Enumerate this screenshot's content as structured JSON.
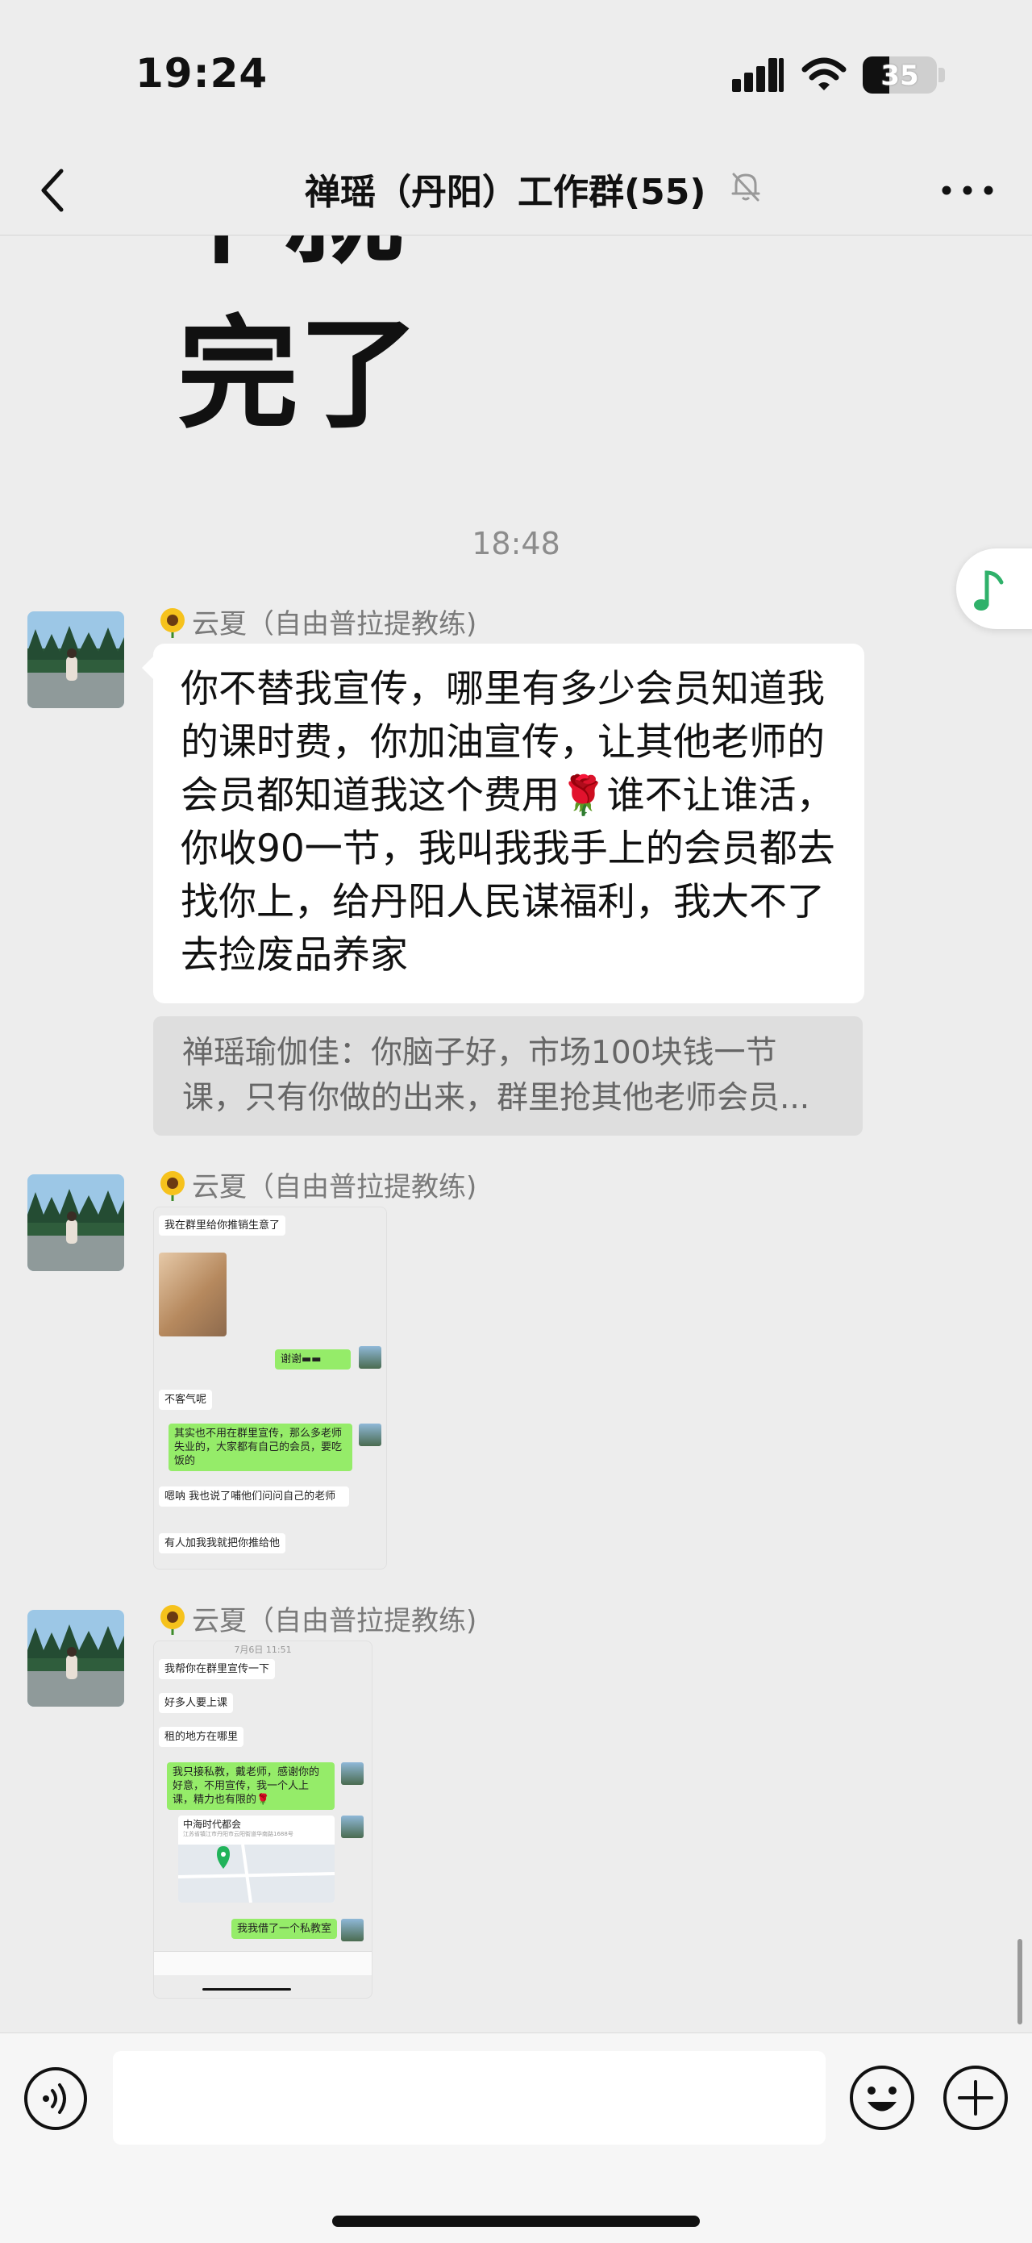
{
  "status_bar": {
    "time": "19:24",
    "battery": "35",
    "battery_level": 0.35
  },
  "nav": {
    "title": "禅瑶（丹阳）工作群(55)"
  },
  "chat": {
    "image_text_line1": "中就",
    "image_text_line2": "完了",
    "timestamp": "18:48",
    "messages": [
      {
        "sender": "云夏（自由普拉提教练)",
        "text": "你不替我宣传，哪里有多少会员知道我的课时费，你加油宣传，让其他老师的会员都知道我这个费用🌹谁不让谁活，你收90一节，我叫我我手上的会员都去找你上，给丹阳人民谋福利，我大不了去捡废品养家",
        "quote": "禅瑶瑜伽佳：你脑子好，市场100块钱一节课，只有你做的出来，群里抢其他老师会员..."
      },
      {
        "sender": "云夏（自由普拉提教练)",
        "screenshot": [
          "我在群里给你推销生意了",
          "谢谢",
          "不客气呢",
          "其实也不用在群里宣传，那么多老师失业的，大家都有自己的会员，要吃饭的",
          "嗯呐 我也说了哺他们问问自己的老师",
          "有人加我我就把你推给他"
        ]
      },
      {
        "sender": "云夏（自由普拉提教练)",
        "screenshot": [
          "7月6日 11:51",
          "我帮你在群里宣传一下",
          "好多人要上课",
          "租的地方在哪里",
          "我只接私教，戴老师，感谢你的好意，不用宣传，我一个人上课，精力也有限的🌹",
          "中海时代都会",
          "江苏省镇江市丹阳市云阳街道华南路1688号",
          "我我借了一个私教室"
        ]
      }
    ]
  },
  "input": {
    "placeholder": ""
  }
}
